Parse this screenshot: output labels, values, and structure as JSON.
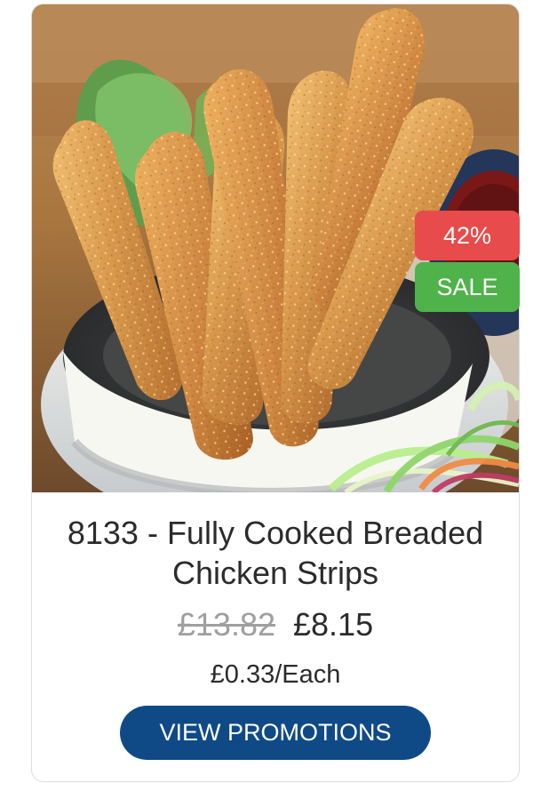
{
  "product": {
    "title": "8133 - Fully Cooked Breaded Chicken Strips",
    "old_price": "£13.82",
    "price": "£8.15",
    "unit_price": "£0.33/Each",
    "discount_badge": "42%",
    "sale_badge": "SALE",
    "button_label": "VIEW PROMOTIONS",
    "image_icon": "breaded-chicken-strips-image"
  },
  "colors": {
    "discount_badge": "#e84b4b",
    "sale_badge": "#4fb24a",
    "button": "#0f4a87"
  }
}
